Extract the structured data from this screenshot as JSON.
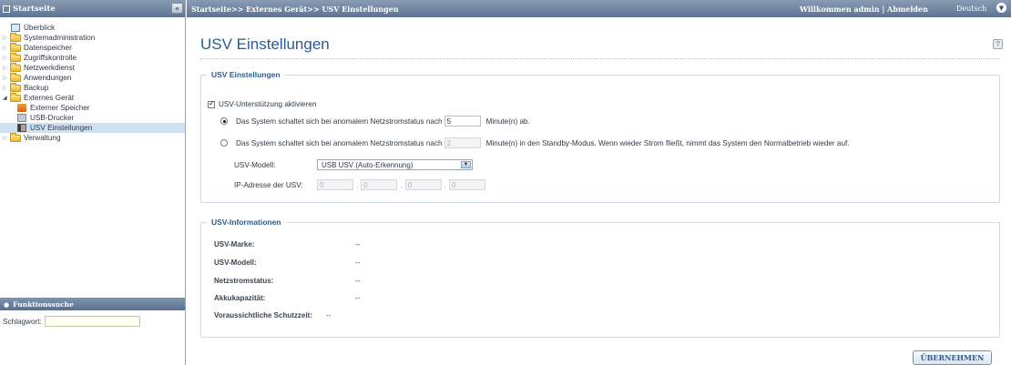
{
  "sidebar": {
    "header": "Startseite",
    "collapse_glyph": "«",
    "items": [
      {
        "label": "Überblick"
      },
      {
        "label": "Systemadministration"
      },
      {
        "label": "Datenspeicher"
      },
      {
        "label": "Zugriffskontrolle"
      },
      {
        "label": "Netzwerkdienst"
      },
      {
        "label": "Anwendungen"
      },
      {
        "label": "Backup"
      },
      {
        "label": "Externes Gerät"
      },
      {
        "label": "Externer Speicher"
      },
      {
        "label": "USB-Drucker"
      },
      {
        "label": "USV Einstellungen"
      },
      {
        "label": "Verwaltung"
      }
    ],
    "search": {
      "header": "Funktionssuche",
      "label": "Schlagwort:",
      "value": ""
    }
  },
  "topbar": {
    "breadcrumb": "Startseite>> Externes Gerät>> USV Einstellungen",
    "welcome": "Willkommen admin | Abmelden",
    "language": "Deutsch"
  },
  "page": {
    "title": "USV Einstellungen",
    "help_glyph": "?"
  },
  "settings": {
    "legend": "USV Einstellungen",
    "enable_label": "USV-Unterstützung aktivieren",
    "enable_checked": true,
    "option1_text": "Das System schaltet sich bei anomalem Netzstromstatus nach",
    "option1_value": "5",
    "option1_suffix": "Minute(n) ab.",
    "option1_selected": true,
    "option2_text": "Das System schaltet sich bei anomalem Netzstromstatus nach",
    "option2_value": "2",
    "option2_suffix": "Minute(n) in den Standby-Modus. Wenn wieder Strom fließt, nimmt das System den Normalbetrieb wieder auf.",
    "option2_selected": false,
    "model_label": "USV-Modell:",
    "model_value": "USB USV (Auto-Erkennung)",
    "ip_label": "IP-Adresse der USV:",
    "ip": [
      "0",
      "0",
      "0",
      "0"
    ]
  },
  "info": {
    "legend": "USV-Informationen",
    "rows": [
      {
        "label": "USV-Marke:",
        "value": "--"
      },
      {
        "label": "USV-Modell:",
        "value": "--"
      },
      {
        "label": "Netzstromstatus:",
        "value": "--"
      },
      {
        "label": "Akkukapazität:",
        "value": "--"
      },
      {
        "label": "Voraussichtliche Schutzzeit:",
        "value": "--"
      }
    ]
  },
  "apply_label": "ÜBERNEHMEN"
}
